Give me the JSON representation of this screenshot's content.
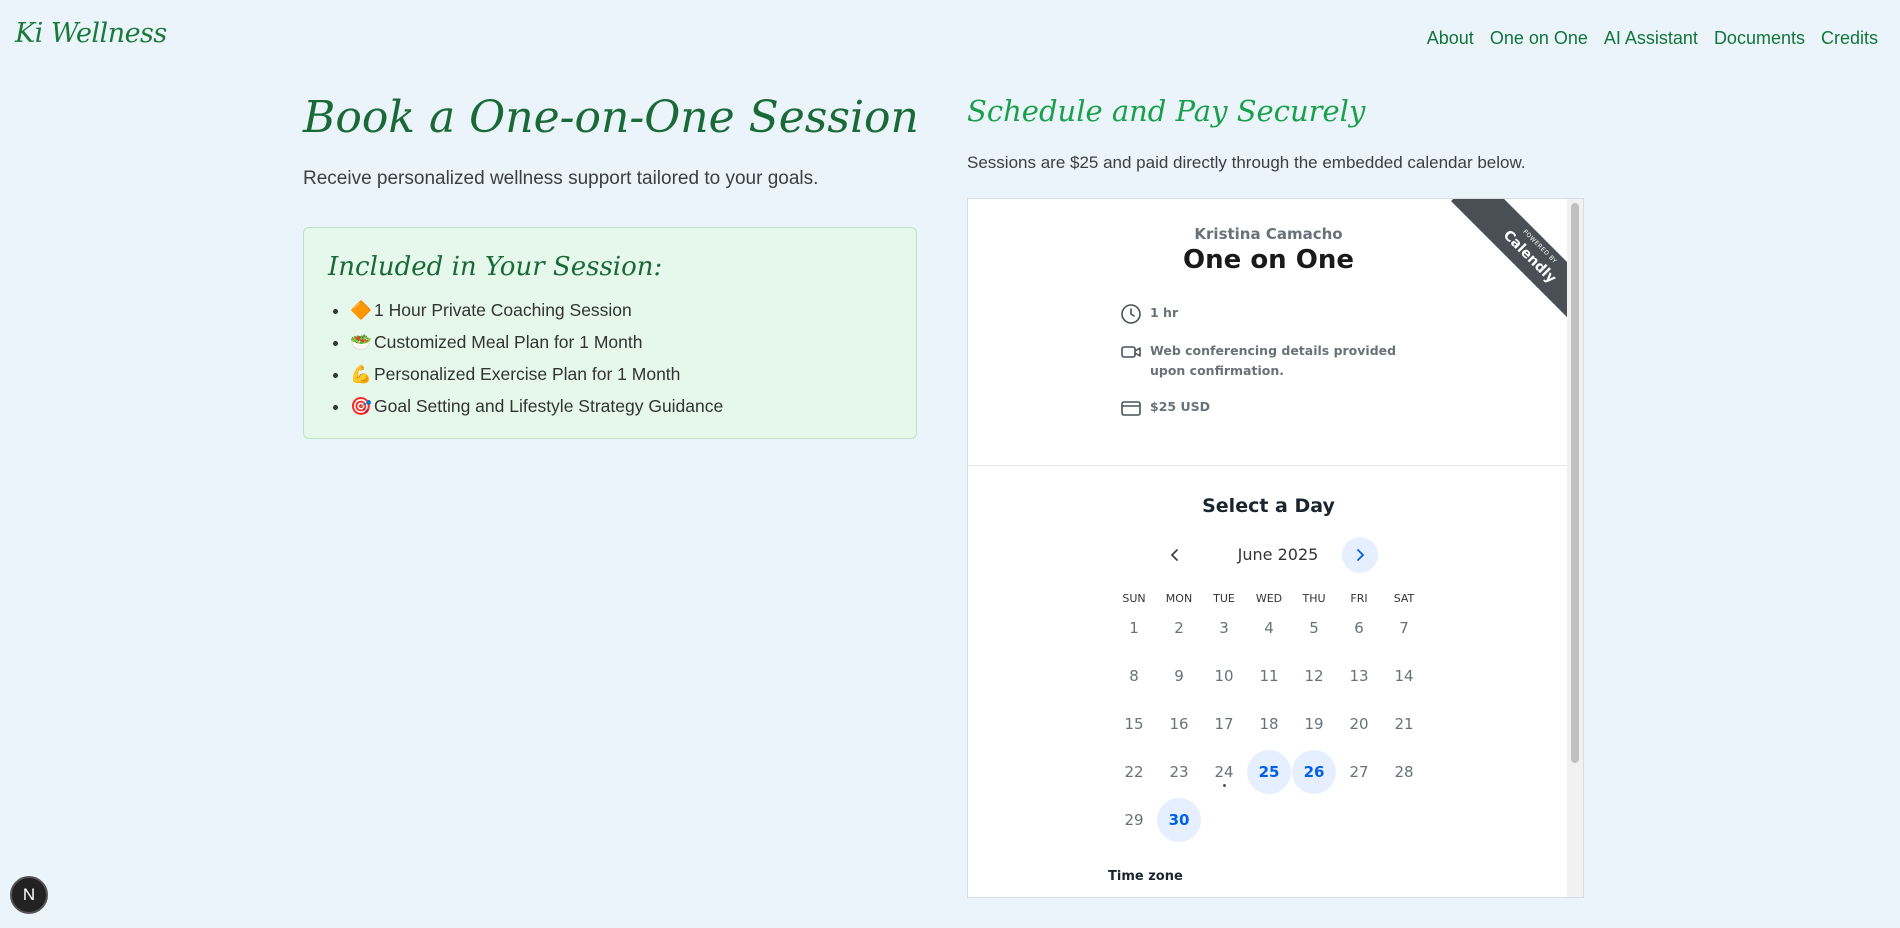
{
  "brand": {
    "logo": "Ki Wellness"
  },
  "nav": [
    "About",
    "One on One",
    "AI Assistant",
    "Documents",
    "Credits"
  ],
  "left": {
    "title": "Book a One-on-One Session",
    "subtitle": "Receive personalized wellness support tailored to your goals.",
    "card": {
      "title": "Included in Your Session:",
      "items": [
        {
          "emoji": "🔶",
          "text": "1 Hour Private Coaching Session"
        },
        {
          "emoji": "🥗",
          "text": "Customized Meal Plan for 1 Month"
        },
        {
          "emoji": "💪",
          "text": "Personalized Exercise Plan for 1 Month"
        },
        {
          "emoji": "🎯",
          "text": "Goal Setting and Lifestyle Strategy Guidance"
        }
      ]
    }
  },
  "right": {
    "title": "Schedule and Pay Securely",
    "subtitle": "Sessions are $25 and paid directly through the embedded calendar below."
  },
  "widget": {
    "ribbon_small": "POWERED BY",
    "ribbon_brand": "Calendly",
    "host": "Kristina Camacho",
    "event": "One on One",
    "duration": "1 hr",
    "location": "Web conferencing details provided upon confirmation.",
    "price": "$25 USD",
    "select_day": "Select a Day",
    "month": "June 2025",
    "weekdays": [
      "SUN",
      "MON",
      "TUE",
      "WED",
      "THU",
      "FRI",
      "SAT"
    ],
    "first_weekday": 0,
    "days_in_month": 30,
    "available_days": [
      25,
      26,
      30
    ],
    "today": 24,
    "timezone_label": "Time zone",
    "icons": [
      "clock-icon",
      "video-icon",
      "card-icon",
      "chevron-left-icon",
      "chevron-right-icon"
    ]
  },
  "badge": {
    "letter": "N"
  }
}
